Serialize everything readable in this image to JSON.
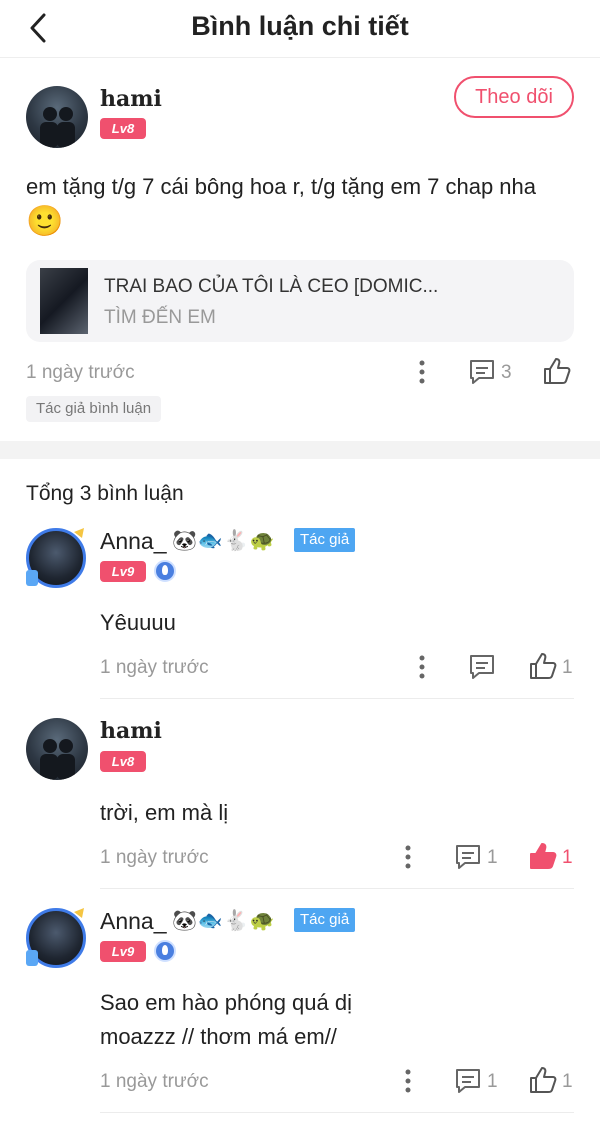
{
  "header": {
    "title": "Bình luận chi tiết"
  },
  "post": {
    "author": "hami",
    "level": "Lv8",
    "follow_label": "Theo dõi",
    "text": "em tặng t/g 7 cái bông hoa r, t/g tặng em 7 chap nha",
    "emoji": "🙂",
    "book": {
      "title": "TRAI BAO CỦA TÔI LÀ CEO [DOMIC...",
      "subtitle": "TÌM ĐẾN EM"
    },
    "time": "1 ngày trước",
    "reply_count": "3",
    "tag": "Tác giả bình luận"
  },
  "replies_header": "Tổng 3 bình luận",
  "replies": [
    {
      "author": "Anna_",
      "emojis": "🐼🐟🐇🐢",
      "author_tag": "Tác giả",
      "level": "Lv9",
      "text": "Yêuuuu",
      "time": "1 ngày trước",
      "reply_count": "",
      "like_count": "1",
      "liked": false
    },
    {
      "author": "hami",
      "level": "Lv8",
      "text": "trời, em mà lị",
      "time": "1 ngày trước",
      "reply_count": "1",
      "like_count": "1",
      "liked": true
    },
    {
      "author": "Anna_",
      "emojis": "🐼🐟🐇🐢",
      "author_tag": "Tác giả",
      "level": "Lv9",
      "text_line1": "Sao em hào phóng quá dị",
      "text_line2": "moazzz // thơm má em//",
      "time": "1 ngày trước",
      "reply_count": "1",
      "like_count": "1",
      "liked": false
    }
  ],
  "colors": {
    "accent": "#f0506e",
    "author_tag": "#4ea6f2",
    "muted": "#999999"
  }
}
